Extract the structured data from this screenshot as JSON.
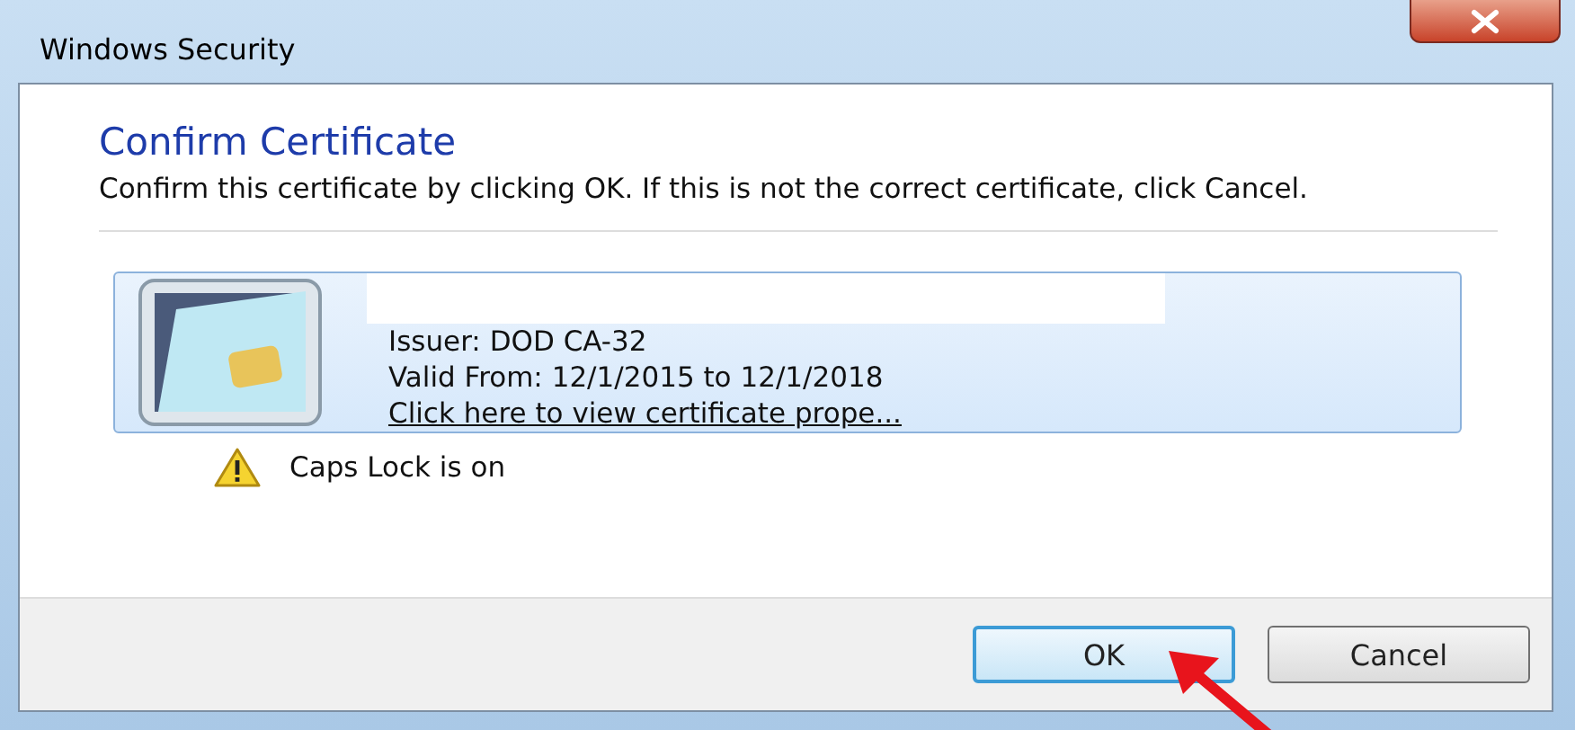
{
  "window": {
    "title": "Windows Security"
  },
  "heading": "Confirm Certificate",
  "message": "Confirm this certificate by clicking OK. If this is not the correct certificate, click Cancel.",
  "certificate": {
    "issuer": "Issuer: DOD CA-32",
    "validity": "Valid From: 12/1/2015 to 12/1/2018",
    "link": "Click here to view certificate prope..."
  },
  "warning": "Caps Lock is on",
  "buttons": [
    {
      "label": "OK",
      "default": true
    },
    {
      "label": "Cancel",
      "default": false
    }
  ]
}
